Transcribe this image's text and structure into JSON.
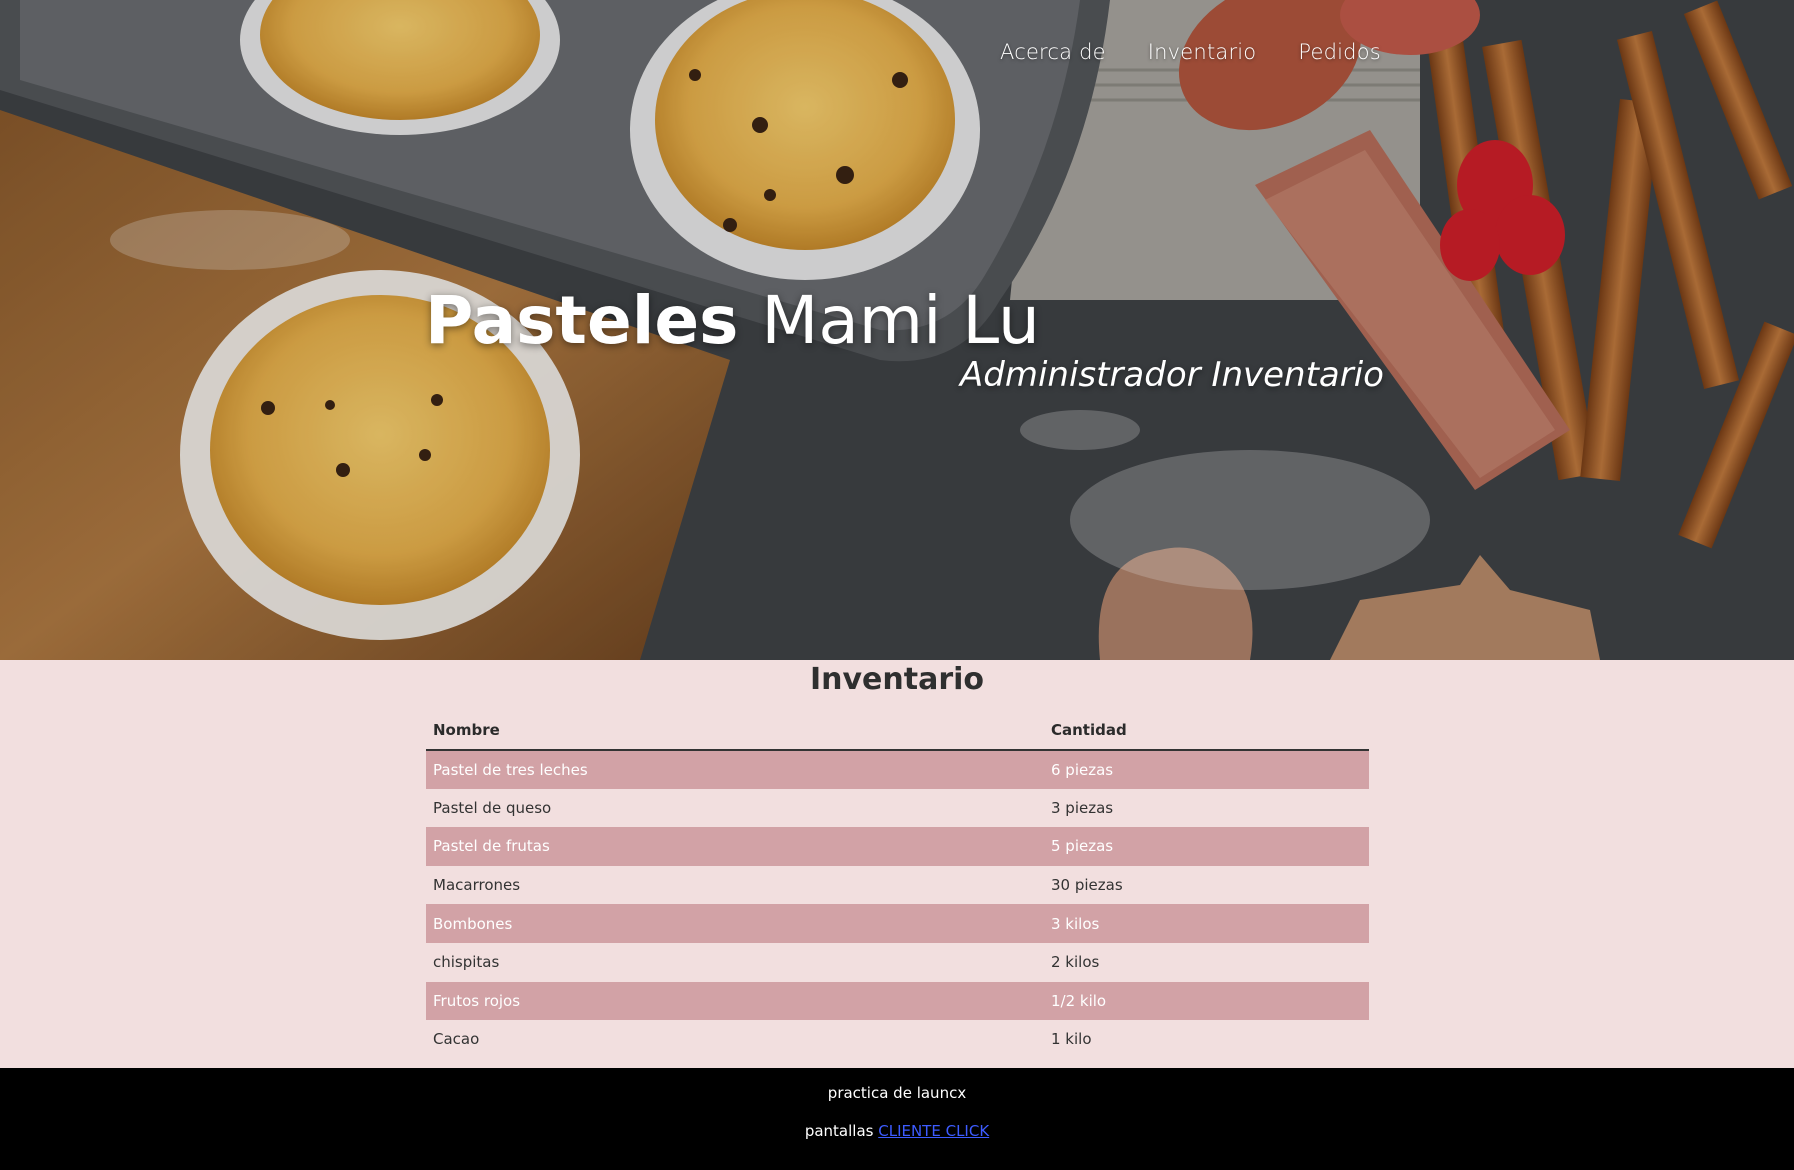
{
  "nav": {
    "items": [
      "Acerca de",
      "Inventario",
      "Pedidos"
    ]
  },
  "hero": {
    "title_bold": "Pasteles",
    "title_light": "Mami Lu",
    "subtitle": "Administrador Inventario"
  },
  "inventory": {
    "heading": "Inventario",
    "columns": [
      "Nombre",
      "Cantidad"
    ],
    "rows": [
      [
        "Pastel de tres leches",
        "6 piezas"
      ],
      [
        "Pastel de queso",
        "3 piezas"
      ],
      [
        "Pastel de frutas",
        "5 piezas"
      ],
      [
        "Macarrones",
        "30 piezas"
      ],
      [
        "Bombones",
        "3 kilos"
      ],
      [
        "chispitas",
        "2 kilos"
      ],
      [
        "Frutos rojos",
        "1/2 kilo"
      ],
      [
        "Cacao",
        "1 kilo"
      ]
    ]
  },
  "footer": {
    "line1": "practica de launcx",
    "line2_prefix": "pantallas",
    "link_text": "CLIENTE CLICK"
  },
  "colors": {
    "page_bg": "#f2dfdf",
    "row_highlight": "#d2a2a6",
    "footer_bg": "#000000",
    "link": "#3d5cff"
  }
}
